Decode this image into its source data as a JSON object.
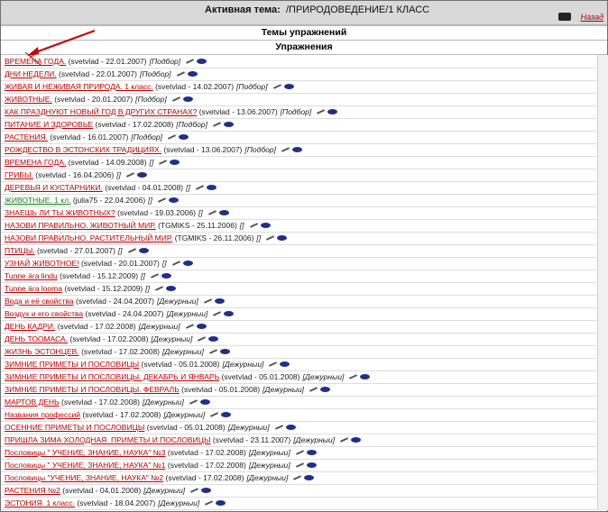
{
  "header": {
    "active_label": "Активная тема:",
    "active_value": "/ПРИРОДОВЕДЕНИЕ/1 КЛАСС",
    "back_label": "Назад"
  },
  "sections": {
    "themes": "Темы упражнений",
    "exercises": "Упражнения"
  },
  "items": [
    {
      "title": "ВРЕМЕНА ГОДА.",
      "meta": "(svetvlad - 22.01.2007)",
      "tag": "[Подбор]",
      "color": "red"
    },
    {
      "title": "ДНИ НЕДЕЛИ.",
      "meta": "(svetvlad - 22.01.2007)",
      "tag": "[Подбор]",
      "color": "red"
    },
    {
      "title": "ЖИВАЯ И НЕЖИВАЯ ПРИРОДА. 1 класс.",
      "meta": "(svetvlad - 14.02.2007)",
      "tag": "[Подбор]",
      "color": "red"
    },
    {
      "title": "ЖИВОТНЫЕ.",
      "meta": "(svetvlad - 20.01.2007)",
      "tag": "[Подбор]",
      "color": "red"
    },
    {
      "title": "КАК ПРАЗДНУЮТ НОВЫЙ ГОД В ДРУГИХ СТРАНАХ?",
      "meta": "(svetvlad - 13.06.2007)",
      "tag": "[Подбор]",
      "color": "red"
    },
    {
      "title": "ПИТАНИЕ И ЗДОРОВЬЕ",
      "meta": "(svetvlad - 17.02.2008)",
      "tag": "[Подбор]",
      "color": "red"
    },
    {
      "title": "РАСТЕНИЯ.",
      "meta": "(svetvlad - 16.01.2007)",
      "tag": "[Подбор]",
      "color": "red"
    },
    {
      "title": "РОЖДЕСТВО В ЭСТОНСКИХ ТРАДИЦИЯХ.",
      "meta": "(svetvlad - 13.06.2007)",
      "tag": "[Подбор]",
      "color": "red"
    },
    {
      "title": "ВРЕМЕНА ГОДА.",
      "meta": "(svetvlad - 14.09.2008)",
      "tag": "[]",
      "color": "red"
    },
    {
      "title": "ГРИБЫ.",
      "meta": "(svetvlad - 16.04.2006)",
      "tag": "[]",
      "color": "red"
    },
    {
      "title": "ДЕРЕВЬЯ И КУСТАРНИКИ.",
      "meta": "(svetvlad - 04.01.2008)",
      "tag": "[]",
      "color": "red"
    },
    {
      "title": "ЖИВОТНЫЕ. 1 кл.",
      "meta": "(julia75 - 22.04.2006)",
      "tag": "[]",
      "color": "green"
    },
    {
      "title": "ЗНАЕШЬ ЛИ ТЫ ЖИВОТНЫХ?",
      "meta": "(svetvlad - 19.03.2006)",
      "tag": "[]",
      "color": "red"
    },
    {
      "title": "НАЗОВИ ПРАВИЛЬНО. ЖИВОТНЫЙ МИР.",
      "meta": "(TGMIKS - 25.11.2006)",
      "tag": "[]",
      "color": "red"
    },
    {
      "title": "НАЗОВИ ПРАВИЛЬНО. РАСТИТЕЛЬНЫЙ МИР.",
      "meta": "(TGMIKS - 26.11.2006)",
      "tag": "[]",
      "color": "red"
    },
    {
      "title": "ПТИЦЫ.",
      "meta": "(svetvlad - 27.01.2007)",
      "tag": "[]",
      "color": "red"
    },
    {
      "title": "УЗНАЙ ЖИВОТНОЕ!",
      "meta": "(svetvlad - 20.01.2007)",
      "tag": "[]",
      "color": "red"
    },
    {
      "title": "Tunne ära lindu",
      "meta": "(svetvlad - 15.12.2009)",
      "tag": "[]",
      "color": "red"
    },
    {
      "title": "Tunne ära looma",
      "meta": "(svetvlad - 15.12.2009)",
      "tag": "[]",
      "color": "red"
    },
    {
      "title": "Вода и её свойства",
      "meta": "(svetvlad - 24.04.2007)",
      "tag": "[Дежурныи]",
      "color": "red"
    },
    {
      "title": "Воздух и его свойства",
      "meta": "(svetvlad - 24.04.2007)",
      "tag": "[Дежурныи]",
      "color": "red"
    },
    {
      "title": "ДЕНЬ КАДРИ.",
      "meta": "(svetvlad - 17.02.2008)",
      "tag": "[Дежурныи]",
      "color": "red"
    },
    {
      "title": "ДЕНЬ ТООМАСА.",
      "meta": "(svetvlad - 17.02.2008)",
      "tag": "[Дежурныи]",
      "color": "red"
    },
    {
      "title": "ЖИЗНЬ ЭСТОНЦЕВ.",
      "meta": "(svetvlad - 17.02.2008)",
      "tag": "[Дежурныи]",
      "color": "red"
    },
    {
      "title": "ЗИМНИЕ ПРИМЕТЫ И ПОСЛОВИЦЫ",
      "meta": "(svetvlad - 05.01.2008)",
      "tag": "[Дежурныи]",
      "color": "red"
    },
    {
      "title": "ЗИМНИЕ ПРИМЕТЫ И ПОСЛОВИЦЫ. ДЕКАБРЬ И ЯНВАРЬ",
      "meta": "(svetvlad - 05.01.2008)",
      "tag": "[Дежурныи]",
      "color": "red"
    },
    {
      "title": "ЗИМНИЕ ПРИМЕТЫ И ПОСЛОВИЦЫ. ФЕВРАЛЬ",
      "meta": "(svetvlad - 05.01.2008)",
      "tag": "[Дежурныи]",
      "color": "red"
    },
    {
      "title": "МАРТОВ ДЕНЬ",
      "meta": "(svetvlad - 17.02.2008)",
      "tag": "[Дежурныи]",
      "color": "red"
    },
    {
      "title": "Названия профессий",
      "meta": "(svetvlad - 17.02.2008)",
      "tag": "[Дежурныи]",
      "color": "red"
    },
    {
      "title": "ОСЕННИЕ ПРИМЕТЫ И ПОСЛОВИЦЫ",
      "meta": "(svetvlad - 05.01.2008)",
      "tag": "[Дежурныи]",
      "color": "red"
    },
    {
      "title": "ПРИШЛА ЗИМА ХОЛОДНАЯ. ПРИМЕТЫ И ПОСЛОВИЦЫ",
      "meta": "(svetvlad - 23.11.2007)",
      "tag": "[Дежурныи]",
      "color": "red"
    },
    {
      "title": "Пословицы \" УЧЕНИЕ, ЗНАНИЕ, НАУКА\" №3",
      "meta": "(svetvlad - 17.02.2008)",
      "tag": "[Дежурныи]",
      "color": "red"
    },
    {
      "title": "Пословицы \" УЧЕНИЕ, ЗНАНИЕ, НАУКА\" №1",
      "meta": "(svetvlad - 17.02.2008)",
      "tag": "[Дежурныи]",
      "color": "red"
    },
    {
      "title": "Пословицы \"УЧЕНИЕ, ЗНАНИЕ, НАУКА\" №2",
      "meta": "(svetvlad - 17.02.2008)",
      "tag": "[Дежурныи]",
      "color": "red"
    },
    {
      "title": "РАСТЕНИЯ №2",
      "meta": "(svetvlad - 04.01.2008)",
      "tag": "[Дежурныи]",
      "color": "red"
    },
    {
      "title": "ЭСТОНИЯ. 1 класс.",
      "meta": "(svetvlad - 18.04.2007)",
      "tag": "[Дежурныи]",
      "color": "red"
    }
  ],
  "icons": {
    "edit": "pencil-icon",
    "view": "eye-icon",
    "back": "hand-pointer-icon"
  },
  "colors": {
    "link_red": "#c00000",
    "link_green": "#178017",
    "header_bg": "#d9d9d9",
    "icon_blue": "#1f2f8c"
  }
}
